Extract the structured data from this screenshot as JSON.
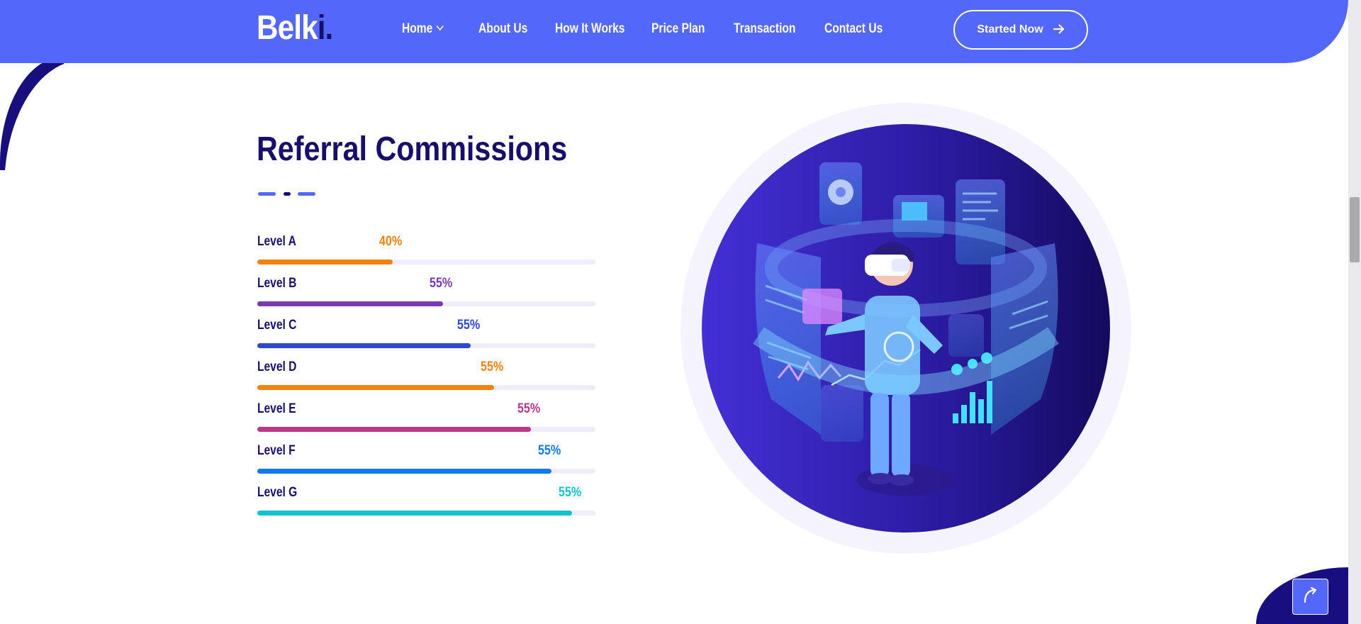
{
  "header": {
    "logo_main": "Belk",
    "logo_accent": "i.",
    "nav": [
      {
        "label": "Home",
        "has_dropdown": true
      },
      {
        "label": "About Us"
      },
      {
        "label": "How It Works"
      },
      {
        "label": "Price Plan"
      },
      {
        "label": "Transaction"
      },
      {
        "label": "Contact Us"
      }
    ],
    "cta_label": "Started Now",
    "cta_icon": "arrow-right-icon"
  },
  "section": {
    "title": "Referral Commissions",
    "levels": [
      {
        "label": "Level A",
        "percent_text": "40%",
        "fill": 0.4,
        "color": "#f4820f"
      },
      {
        "label": "Level B",
        "percent_text": "55%",
        "fill": 0.55,
        "color": "#7b3ab0"
      },
      {
        "label": "Level C",
        "percent_text": "55%",
        "fill": 0.63,
        "color": "#2f47d6"
      },
      {
        "label": "Level D",
        "percent_text": "55%",
        "fill": 0.7,
        "color": "#f4820f"
      },
      {
        "label": "Level E",
        "percent_text": "55%",
        "fill": 0.81,
        "color": "#b9388c"
      },
      {
        "label": "Level F",
        "percent_text": "55%",
        "fill": 0.87,
        "color": "#1179f0"
      },
      {
        "label": "Level G",
        "percent_text": "55%",
        "fill": 0.93,
        "color": "#12c2d1"
      }
    ]
  },
  "theme": {
    "primary": "#5367f8",
    "dark": "#170f6b",
    "track": "#efedfa"
  },
  "scroll_top_icon": "scroll-to-top-icon"
}
